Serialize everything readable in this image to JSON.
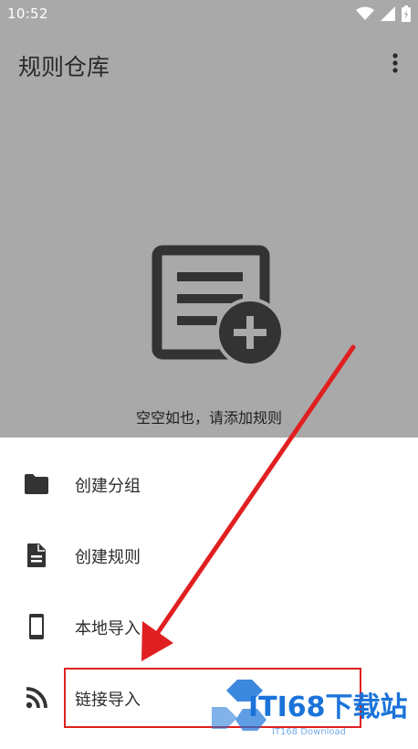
{
  "status_bar": {
    "time": "10:52",
    "icons": [
      "wifi-icon",
      "signal-icon",
      "battery-icon"
    ]
  },
  "app_bar": {
    "title": "规则仓库",
    "menu_icon": "more-vert-icon"
  },
  "empty_state": {
    "icon": "add-list-icon",
    "message": "空空如也，请添加规则"
  },
  "sheet": {
    "items": [
      {
        "label": "创建分组",
        "icon": "folder-icon"
      },
      {
        "label": "创建规则",
        "icon": "file-icon"
      },
      {
        "label": "本地导入",
        "icon": "phone-icon"
      },
      {
        "label": "链接导入",
        "icon": "rss-icon"
      }
    ]
  },
  "watermark": {
    "brand": "ITI68下载站",
    "sub": "IT168 Download"
  },
  "colors": {
    "overlay": "#a9a9a9",
    "highlight": "#e02020",
    "icon": "#333333",
    "watermark": "#1a73d9"
  }
}
